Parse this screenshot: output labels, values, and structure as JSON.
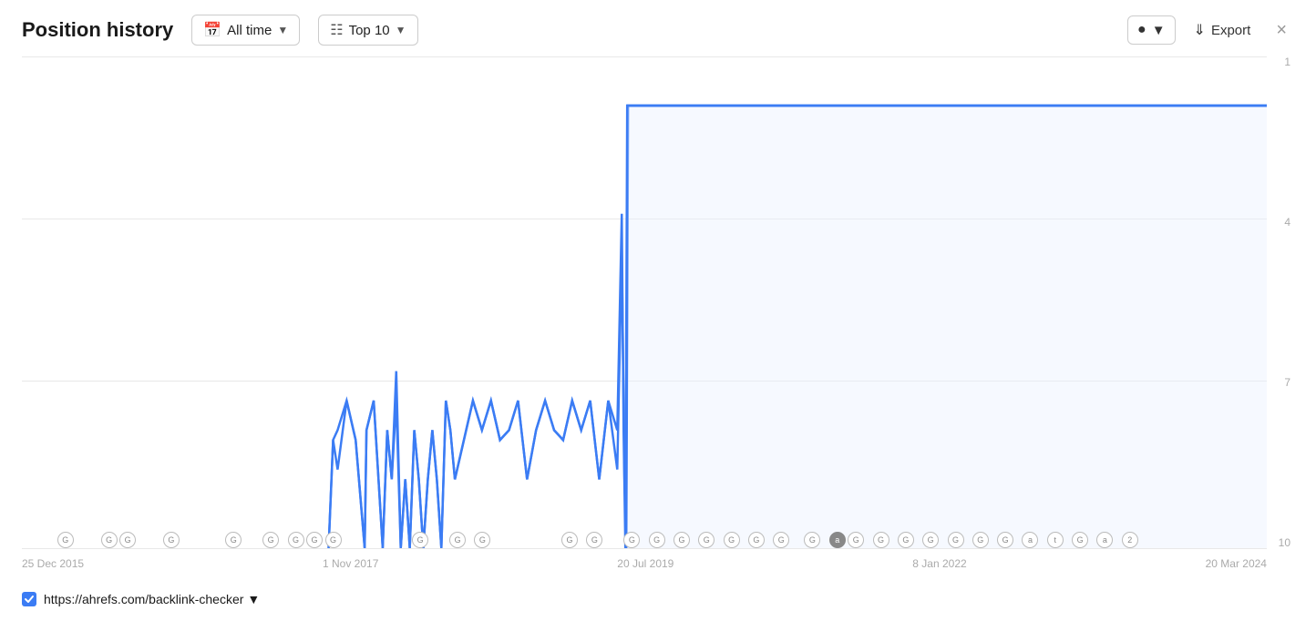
{
  "header": {
    "title": "Position history",
    "filter_time_label": "All time",
    "filter_top_label": "Top 10",
    "export_label": "Export",
    "close_label": "×"
  },
  "chart": {
    "y_labels": [
      "1",
      "4",
      "7",
      "10"
    ],
    "x_labels": [
      "25 Dec 2015",
      "1 Nov 2017",
      "20 Jul 2019",
      "8 Jan 2022",
      "20 Mar 2024"
    ],
    "line_color": "#3b7cf4",
    "grid_color": "#e8e8e8"
  },
  "footer": {
    "url": "https://ahrefs.com/backlink-checker"
  },
  "events": [
    {
      "label": "G",
      "left_pct": 3.5
    },
    {
      "label": "GG",
      "left_pct": 8
    },
    {
      "label": "G",
      "left_pct": 13
    },
    {
      "label": "G",
      "left_pct": 17
    },
    {
      "label": "GGGG",
      "left_pct": 22
    },
    {
      "label": "G",
      "left_pct": 30
    },
    {
      "label": "GG",
      "left_pct": 34
    },
    {
      "label": "GG",
      "left_pct": 44
    },
    {
      "label": "GGG",
      "left_pct": 50
    },
    {
      "label": "G",
      "left_pct": 57
    },
    {
      "label": "GG",
      "left_pct": 61
    },
    {
      "label": "GGGG",
      "left_pct": 67
    },
    {
      "label": "G",
      "left_pct": 73
    },
    {
      "label": "GGG",
      "left_pct": 79
    },
    {
      "label": "GG",
      "left_pct": 84
    },
    {
      "label": "G",
      "left_pct": 88
    },
    {
      "label": "GG",
      "left_pct": 92
    },
    {
      "label": "a2",
      "left_pct": 96
    }
  ]
}
